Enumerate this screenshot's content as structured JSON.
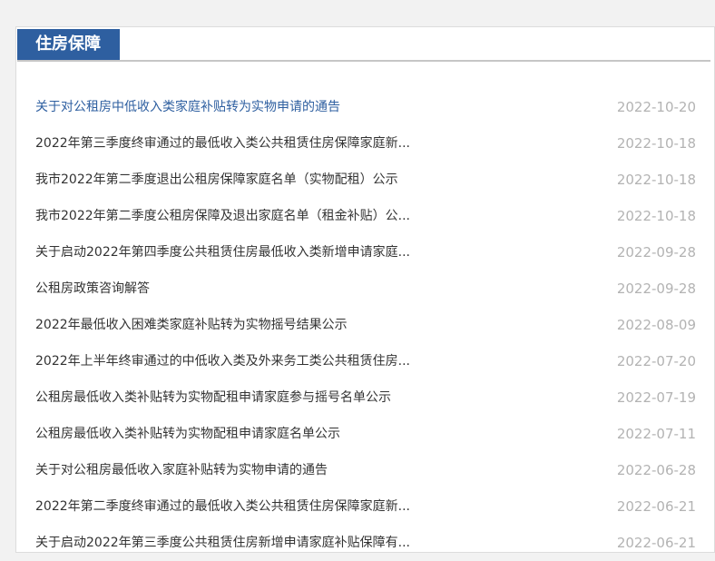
{
  "tab": {
    "label": "住房保障"
  },
  "items": [
    {
      "title": "关于对公租房中低收入类家庭补贴转为实物申请的通告",
      "date": "2022-10-20"
    },
    {
      "title": "2022年第三季度终审通过的最低收入类公共租赁住房保障家庭新...",
      "date": "2022-10-18"
    },
    {
      "title": "我市2022年第二季度退出公租房保障家庭名单（实物配租）公示",
      "date": "2022-10-18"
    },
    {
      "title": "我市2022年第二季度公租房保障及退出家庭名单（租金补贴）公...",
      "date": "2022-10-18"
    },
    {
      "title": "关于启动2022年第四季度公共租赁住房最低收入类新增申请家庭...",
      "date": "2022-09-28"
    },
    {
      "title": "公租房政策咨询解答",
      "date": "2022-09-28"
    },
    {
      "title": "2022年最低收入困难类家庭补贴转为实物摇号结果公示",
      "date": "2022-08-09"
    },
    {
      "title": "2022年上半年终审通过的中低收入类及外来务工类公共租赁住房...",
      "date": "2022-07-20"
    },
    {
      "title": "公租房最低收入类补贴转为实物配租申请家庭参与摇号名单公示",
      "date": "2022-07-19"
    },
    {
      "title": "公租房最低收入类补贴转为实物配租申请家庭名单公示",
      "date": "2022-07-11"
    },
    {
      "title": "关于对公租房最低收入家庭补贴转为实物申请的通告",
      "date": "2022-06-28"
    },
    {
      "title": "2022年第二季度终审通过的最低收入类公共租赁住房保障家庭新...",
      "date": "2022-06-21"
    },
    {
      "title": "关于启动2022年第三季度公共租赁住房新增申请家庭补贴保障有...",
      "date": "2022-06-21"
    }
  ],
  "colors": {
    "accent": "#2e5fa0",
    "date": "#b3b3b3",
    "text": "#333333"
  }
}
